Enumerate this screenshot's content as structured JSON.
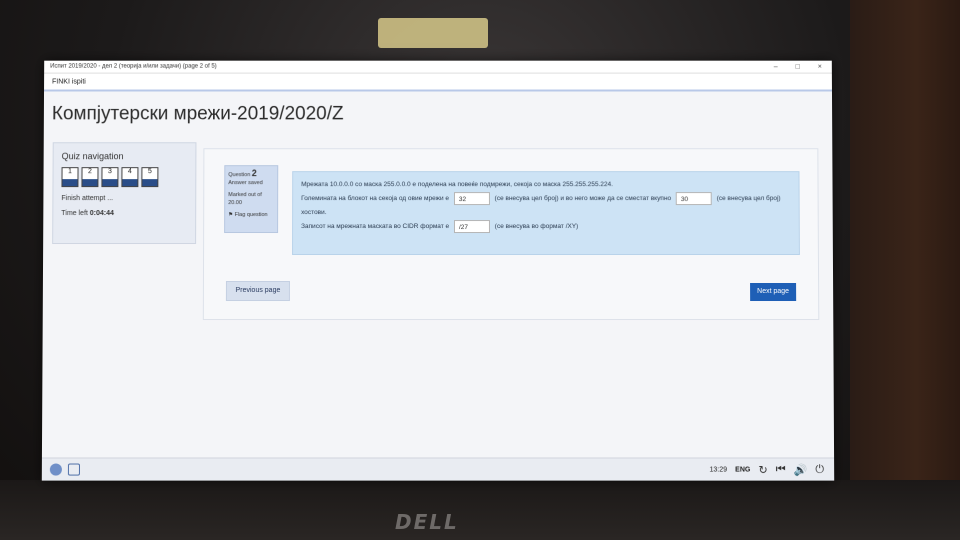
{
  "window": {
    "title": "Испит 2019/2020 - дел 2 (теорија и/или задачи) (page 2 of 5)",
    "controls": [
      "–",
      "□",
      "×"
    ]
  },
  "app": {
    "name": "FINKI ispiti"
  },
  "course_title": "Компјутерски мрежи-2019/2020/Z",
  "quiz_nav": {
    "title": "Quiz navigation",
    "questions": [
      "1",
      "2",
      "3",
      "4",
      "5"
    ],
    "finish_label": "Finish attempt ...",
    "time_left_label": "Time left",
    "time_left_value": "0:04:44"
  },
  "question": {
    "label": "Question",
    "number": "2",
    "status": "Answer saved",
    "marked": "Marked out of 20.00",
    "flag": "Flag question",
    "text1": "Мрежата 10.0.0.0 со маска 255.0.0.0 е поделена на повеќе подмрежи, секоја со маска 255.255.255.224.",
    "text2a": "Големината на блокот на секоја од овие мрежи е",
    "input1": "32",
    "text2b": "(се внесува цел број) и во него може да се сместат вкупно",
    "input2": "30",
    "text2c": "(се внесува цел број) хостови.",
    "text3a": "Записот на мрежната маската во CIDR формат е",
    "input3": "/27",
    "text3b": "(се внесува во формат /XY)"
  },
  "buttons": {
    "previous": "Previous page",
    "next": "Next page"
  },
  "taskbar": {
    "time": "13:29",
    "lang": "ENG"
  },
  "laptop_brand": "DELL"
}
